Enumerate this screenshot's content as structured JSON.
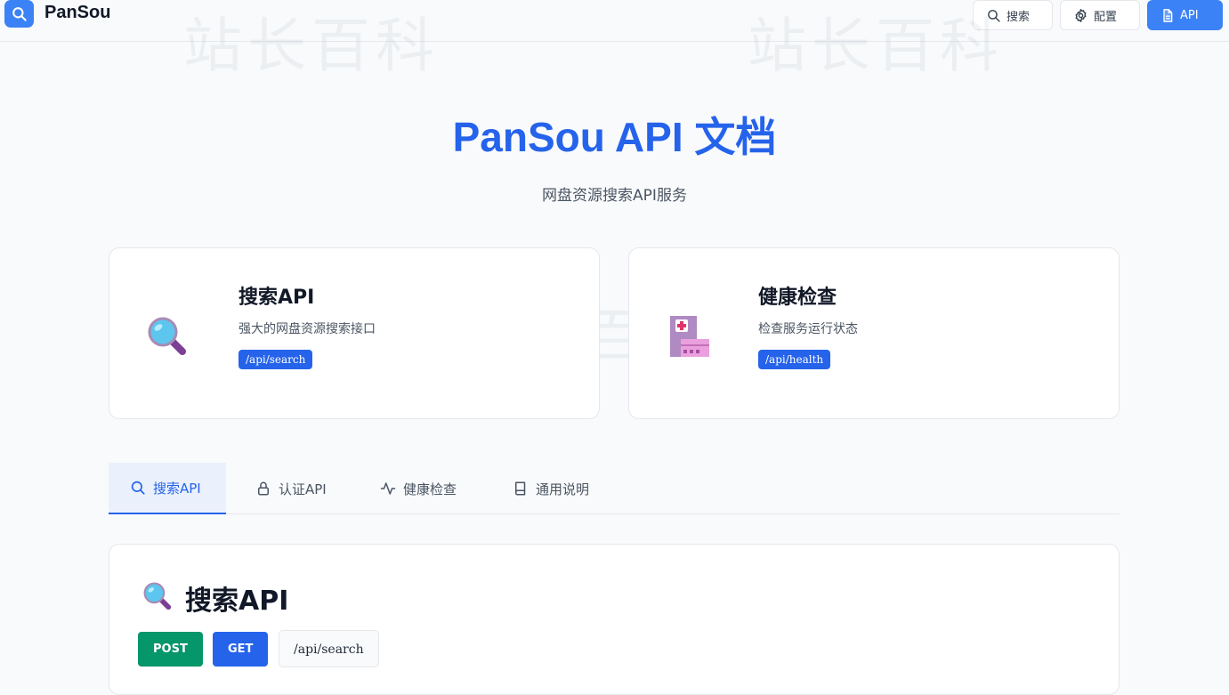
{
  "header": {
    "brand": "PanSou",
    "nav": {
      "search_label": "搜索",
      "config_label": "配置",
      "api_label": "API"
    }
  },
  "watermark": {
    "text": "站长百科"
  },
  "hero": {
    "title": "PanSou API 文档",
    "subtitle": "网盘资源搜索API服务"
  },
  "cards": [
    {
      "icon": "magnifying-glass-emoji",
      "title": "搜索API",
      "desc": "强大的网盘资源搜索接口",
      "endpoint": "/api/search"
    },
    {
      "icon": "hospital-emoji",
      "title": "健康检查",
      "desc": "检查服务运行状态",
      "endpoint": "/api/health"
    }
  ],
  "tabs": [
    {
      "icon": "search-icon",
      "label": "搜索API",
      "active": true
    },
    {
      "icon": "lock-icon",
      "label": "认证API",
      "active": false
    },
    {
      "icon": "activity-icon",
      "label": "健康检查",
      "active": false
    },
    {
      "icon": "book-icon",
      "label": "通用说明",
      "active": false
    }
  ],
  "section": {
    "icon": "magnifying-glass-emoji",
    "title": "搜索API",
    "methods": [
      "POST",
      "GET"
    ],
    "endpoint": "/api/search"
  },
  "colors": {
    "primary": "#2563eb",
    "accent": "#3b82f6",
    "post": "#059669",
    "background": "#f9fafb"
  }
}
